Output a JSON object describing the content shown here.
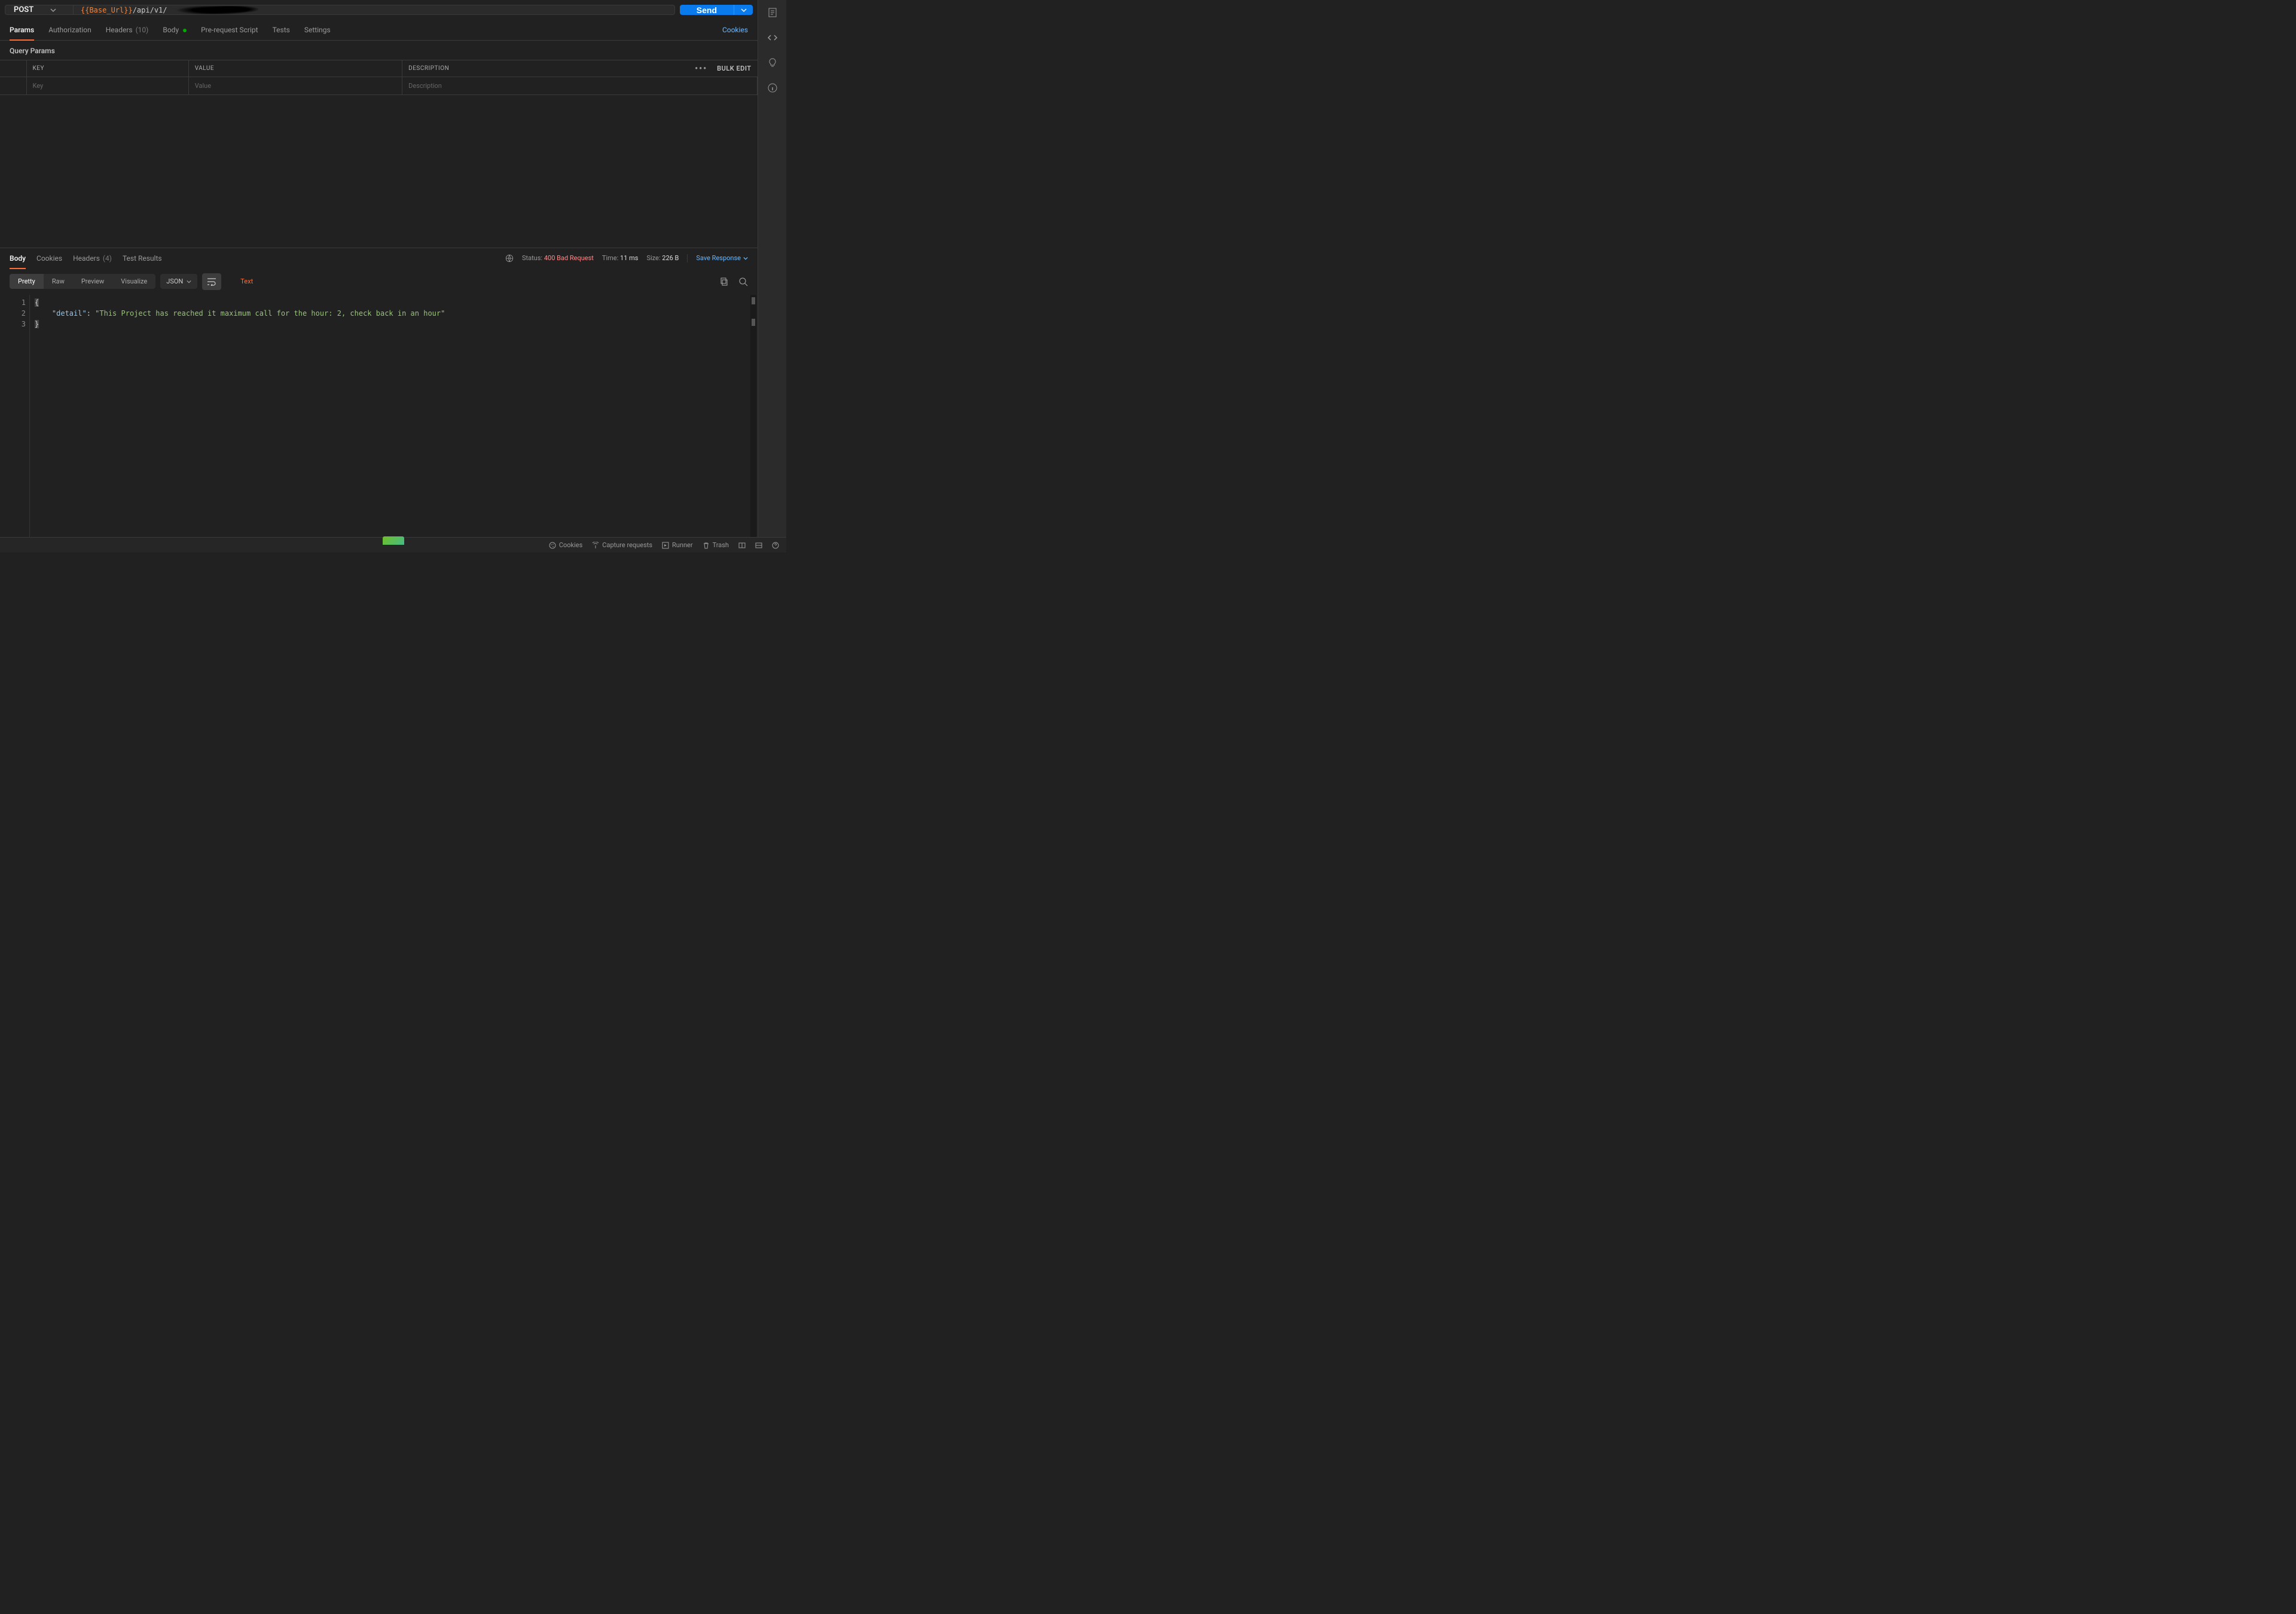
{
  "request": {
    "method": "POST",
    "url_variable": "{{Base_Url}}",
    "url_path": "/api/v1/",
    "send_label": "Send"
  },
  "request_tabs": {
    "params": "Params",
    "authorization": "Authorization",
    "headers_label": "Headers",
    "headers_count": "(10)",
    "body": "Body",
    "pre_request": "Pre-request Script",
    "tests": "Tests",
    "settings": "Settings",
    "cookies_link": "Cookies"
  },
  "params_section": {
    "title": "Query Params",
    "col_key": "KEY",
    "col_value": "VALUE",
    "col_desc": "DESCRIPTION",
    "placeholder_key": "Key",
    "placeholder_value": "Value",
    "placeholder_desc": "Description",
    "bulk_edit": "Bulk Edit"
  },
  "response_tabs": {
    "body": "Body",
    "cookies": "Cookies",
    "headers_label": "Headers",
    "headers_count": "(4)",
    "test_results": "Test Results"
  },
  "response_status": {
    "status_label": "Status:",
    "status_value": "400 Bad Request",
    "time_label": "Time:",
    "time_value": "11 ms",
    "size_label": "Size:",
    "size_value": "226 B",
    "save_response": "Save Response"
  },
  "view": {
    "pretty": "Pretty",
    "raw": "Raw",
    "preview": "Preview",
    "visualize": "Visualize",
    "format": "JSON",
    "text_label": "Text"
  },
  "response_body": {
    "line1": "{",
    "line2_key": "\"detail\"",
    "line2_punct": ": ",
    "line2_val": "\"This Project has reached it maximum call for the hour: 2, check back in an hour\"",
    "line3": "}"
  },
  "footer": {
    "cookies": "Cookies",
    "capture": "Capture requests",
    "runner": "Runner",
    "trash": "Trash"
  }
}
